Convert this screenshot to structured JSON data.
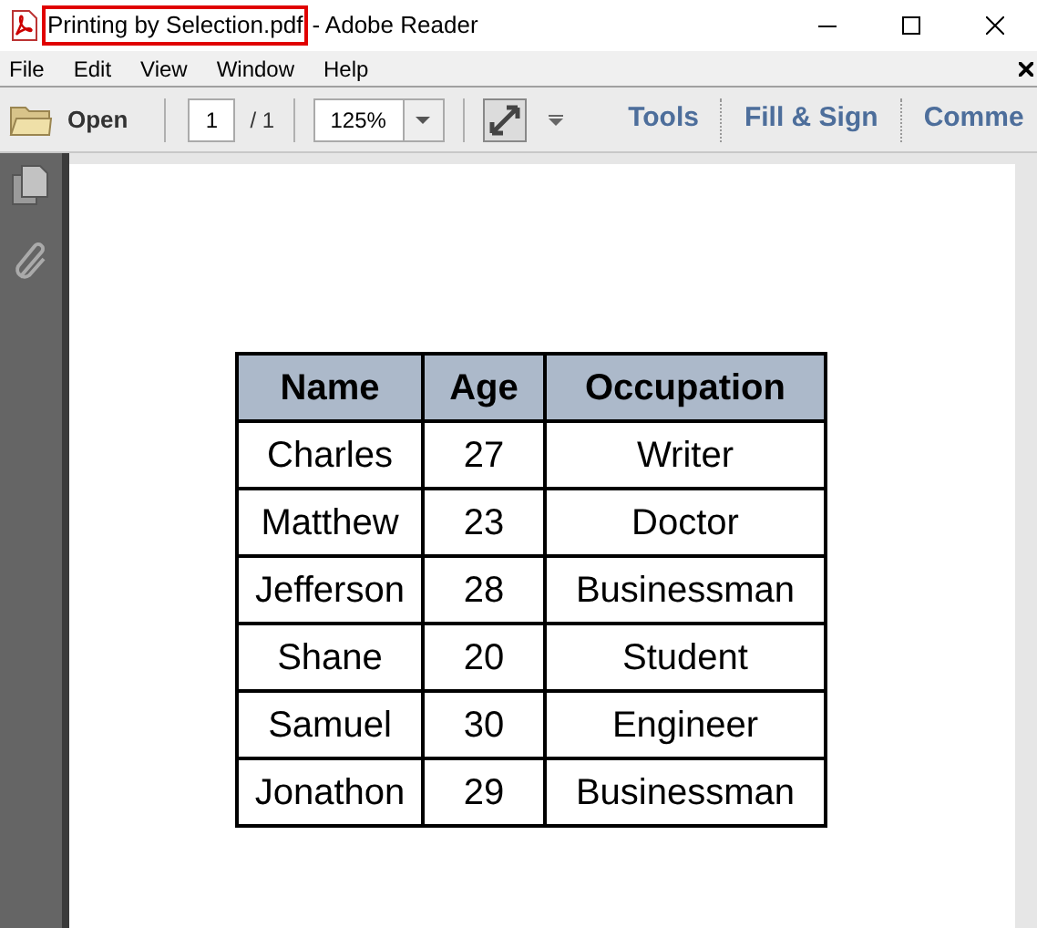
{
  "window": {
    "filename": "Printing by Selection.pdf",
    "app_title": "- Adobe Reader"
  },
  "menu": [
    "File",
    "Edit",
    "View",
    "Window",
    "Help"
  ],
  "toolbar": {
    "open": "Open",
    "page": "1",
    "page_total": "/ 1",
    "zoom": "125%",
    "links": [
      "Tools",
      "Fill & Sign",
      "Comme"
    ]
  },
  "table": {
    "columns": [
      "Name",
      "Age",
      "Occupation"
    ],
    "rows": [
      [
        "Charles",
        "27",
        "Writer"
      ],
      [
        "Matthew",
        "23",
        "Doctor"
      ],
      [
        "Jefferson",
        "28",
        "Businessman"
      ],
      [
        "Shane",
        "20",
        "Student"
      ],
      [
        "Samuel",
        "30",
        "Engineer"
      ],
      [
        "Jonathon",
        "29",
        "Businessman"
      ]
    ]
  }
}
